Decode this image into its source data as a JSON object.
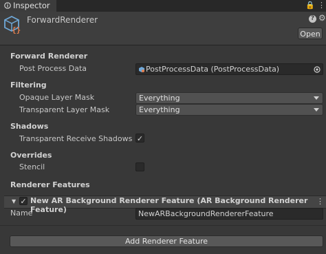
{
  "tab": {
    "title": "Inspector",
    "lock_glyph": "🔒",
    "menu_glyph": "⋮"
  },
  "asset": {
    "name": "ForwardRenderer",
    "open_label": "Open",
    "help_glyph": "?",
    "settings_glyph": "⚙"
  },
  "forward_renderer": {
    "section": "Forward Renderer",
    "post_process_label": "Post Process Data",
    "post_process_value": "PostProcessData (PostProcessData)"
  },
  "filtering": {
    "section": "Filtering",
    "opaque_label": "Opaque Layer Mask",
    "opaque_value": "Everything",
    "transparent_label": "Transparent Layer Mask",
    "transparent_value": "Everything"
  },
  "shadows": {
    "section": "Shadows",
    "receive_label": "Transparent Receive Shadows",
    "receive_checked": true,
    "check_glyph": "✓"
  },
  "overrides": {
    "section": "Overrides",
    "stencil_label": "Stencil",
    "stencil_checked": false
  },
  "renderer_features": {
    "section": "Renderer Features",
    "feature_title": "New AR Background Renderer Feature (AR Background Renderer Feature)",
    "feature_check_glyph": "✓",
    "feature_menu_glyph": "⋮",
    "fold_glyph": "▼",
    "name_label": "Name",
    "name_value": "NewARBackgroundRendererFeature",
    "add_label": "Add Renderer Feature"
  },
  "colors": {
    "background": "#383838",
    "header": "#3e3e3e",
    "field": "#2a2a2a",
    "accent_icon": "#e5804f",
    "cube_icon": "#6fa8d8"
  }
}
